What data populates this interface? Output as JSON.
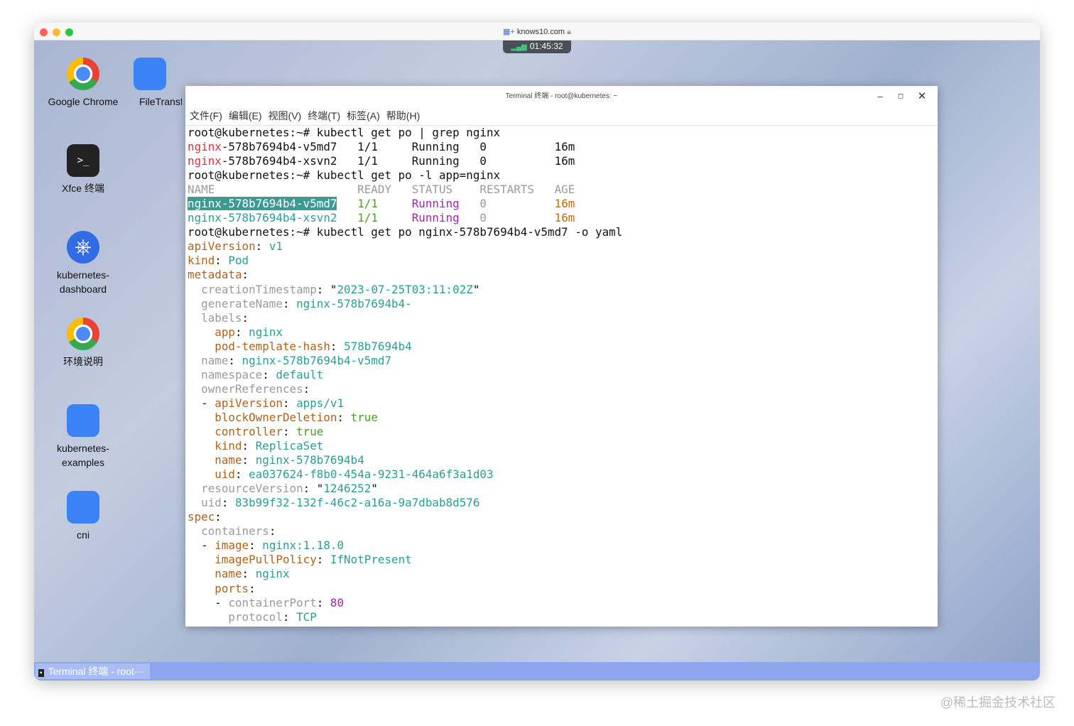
{
  "browser": {
    "url": "knows10.com",
    "clock": "01:45:32"
  },
  "desktop": {
    "icons": [
      "Google Chrome",
      "FileTransfer",
      "Xfce 终端",
      "kubernetes-\ndashboard",
      "环境说明",
      "kubernetes-\nexamples",
      "cni"
    ]
  },
  "taskbar": {
    "item": "Terminal 终端 - root···"
  },
  "terminal": {
    "title": "Terminal 终端 - root@kubernetes: ~",
    "menu": [
      "文件(F)",
      "编辑(E)",
      "视图(V)",
      "终端(T)",
      "标签(A)",
      "帮助(H)"
    ],
    "lines": [
      [
        [
          "w",
          "root@kubernetes:~# kubectl get po | grep nginx"
        ]
      ],
      [
        [
          "r",
          "nginx"
        ],
        [
          "w",
          "-578b7694b4-v5md7   1/1     Running   0          16m"
        ]
      ],
      [
        [
          "r",
          "nginx"
        ],
        [
          "w",
          "-578b7694b4-xsvn2   1/1     Running   0          16m"
        ]
      ],
      [
        [
          "w",
          "root@kubernetes:~# kubectl get po -l app=nginx"
        ]
      ],
      [
        [
          "g",
          "NAME                     READY   STATUS    RESTARTS   AGE"
        ]
      ],
      [
        [
          "h",
          "nginx-578b7694b4-v5md7"
        ],
        [
          "w",
          "   "
        ],
        [
          "gr",
          "1/1"
        ],
        [
          "w",
          "     "
        ],
        [
          "p",
          "Running"
        ],
        [
          "w",
          "   "
        ],
        [
          "g",
          "0"
        ],
        [
          "w",
          "          "
        ],
        [
          "a",
          "16m"
        ]
      ],
      [
        [
          "t",
          "nginx-578b7694b4-xsvn2"
        ],
        [
          "w",
          "   "
        ],
        [
          "gr",
          "1/1"
        ],
        [
          "w",
          "     "
        ],
        [
          "p",
          "Running"
        ],
        [
          "w",
          "   "
        ],
        [
          "g",
          "0"
        ],
        [
          "w",
          "          "
        ],
        [
          "a",
          "16m"
        ]
      ],
      [
        [
          "w",
          "root@kubernetes:~# kubectl get po nginx-578b7694b4-v5md7 -o yaml"
        ]
      ],
      [
        [
          "o",
          "apiVersion"
        ],
        [
          "w",
          ": "
        ],
        [
          "t",
          "v1"
        ]
      ],
      [
        [
          "o",
          "kind"
        ],
        [
          "w",
          ": "
        ],
        [
          "t",
          "Pod"
        ]
      ],
      [
        [
          "o",
          "metadata"
        ],
        [
          "w",
          ":"
        ]
      ],
      [
        [
          "g",
          "  creationTimestamp"
        ],
        [
          "w",
          ": \""
        ],
        [
          "t",
          "2023-07-25T03:11:02Z"
        ],
        [
          "w",
          "\""
        ]
      ],
      [
        [
          "g",
          "  generateName"
        ],
        [
          "w",
          ": "
        ],
        [
          "t",
          "nginx-578b7694b4-"
        ]
      ],
      [
        [
          "g",
          "  labels"
        ],
        [
          "w",
          ":"
        ]
      ],
      [
        [
          "o",
          "    app"
        ],
        [
          "w",
          ": "
        ],
        [
          "t",
          "nginx"
        ]
      ],
      [
        [
          "o",
          "    pod-template-hash"
        ],
        [
          "w",
          ": "
        ],
        [
          "t",
          "578b7694b4"
        ]
      ],
      [
        [
          "g",
          "  name"
        ],
        [
          "w",
          ": "
        ],
        [
          "t",
          "nginx-578b7694b4-v5md7"
        ]
      ],
      [
        [
          "g",
          "  namespace"
        ],
        [
          "w",
          ": "
        ],
        [
          "t",
          "default"
        ]
      ],
      [
        [
          "g",
          "  ownerReferences"
        ],
        [
          "w",
          ":"
        ]
      ],
      [
        [
          "w",
          "  - "
        ],
        [
          "o",
          "apiVersion"
        ],
        [
          "w",
          ": "
        ],
        [
          "t",
          "apps/v1"
        ]
      ],
      [
        [
          "o",
          "    blockOwnerDeletion"
        ],
        [
          "w",
          ": "
        ],
        [
          "gr",
          "true"
        ]
      ],
      [
        [
          "o",
          "    controller"
        ],
        [
          "w",
          ": "
        ],
        [
          "gr",
          "true"
        ]
      ],
      [
        [
          "o",
          "    kind"
        ],
        [
          "w",
          ": "
        ],
        [
          "t",
          "ReplicaSet"
        ]
      ],
      [
        [
          "o",
          "    name"
        ],
        [
          "w",
          ": "
        ],
        [
          "t",
          "nginx-578b7694b4"
        ]
      ],
      [
        [
          "o",
          "    uid"
        ],
        [
          "w",
          ": "
        ],
        [
          "t",
          "ea037624-f8b0-454a-9231-464a6f3a1d03"
        ]
      ],
      [
        [
          "g",
          "  resourceVersion"
        ],
        [
          "w",
          ": \""
        ],
        [
          "t",
          "1246252"
        ],
        [
          "w",
          "\""
        ]
      ],
      [
        [
          "g",
          "  uid"
        ],
        [
          "w",
          ": "
        ],
        [
          "t",
          "83b99f32-132f-46c2-a16a-9a7dbab8d576"
        ]
      ],
      [
        [
          "o",
          "spec"
        ],
        [
          "w",
          ":"
        ]
      ],
      [
        [
          "g",
          "  containers"
        ],
        [
          "w",
          ":"
        ]
      ],
      [
        [
          "w",
          "  - "
        ],
        [
          "o",
          "image"
        ],
        [
          "w",
          ": "
        ],
        [
          "t",
          "nginx:1.18.0"
        ]
      ],
      [
        [
          "o",
          "    imagePullPolicy"
        ],
        [
          "w",
          ": "
        ],
        [
          "t",
          "IfNotPresent"
        ]
      ],
      [
        [
          "o",
          "    name"
        ],
        [
          "w",
          ": "
        ],
        [
          "t",
          "nginx"
        ]
      ],
      [
        [
          "o",
          "    ports"
        ],
        [
          "w",
          ":"
        ]
      ],
      [
        [
          "w",
          "    - "
        ],
        [
          "g",
          "containerPort"
        ],
        [
          "w",
          ": "
        ],
        [
          "p",
          "80"
        ]
      ],
      [
        [
          "g",
          "      protocol"
        ],
        [
          "w",
          ": "
        ],
        [
          "t",
          "TCP"
        ]
      ]
    ]
  },
  "watermark": "@稀土掘金技术社区"
}
